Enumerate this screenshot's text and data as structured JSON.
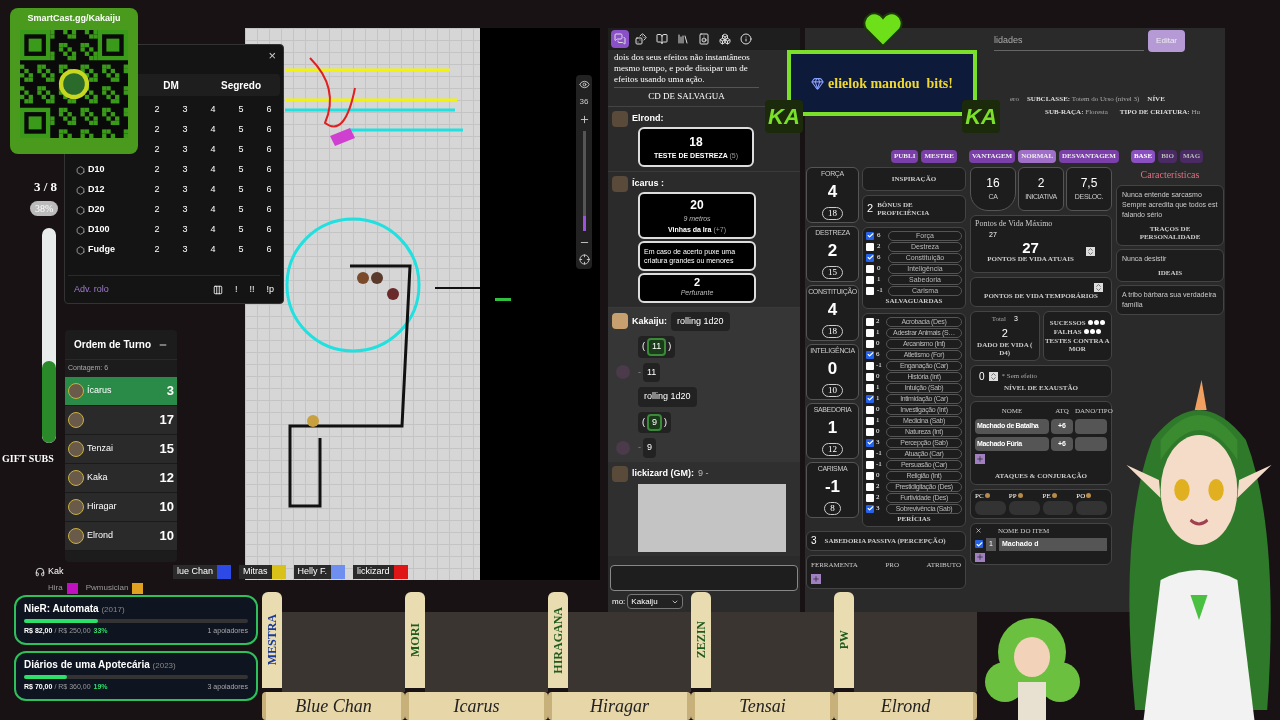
{
  "qr_card": {
    "title": "SmartCast.gg/Kakaiju"
  },
  "sub_goal": {
    "count": "3 / 8",
    "percent": "38%",
    "level": 0.38,
    "label": "GIFT SUBS"
  },
  "dice_panel": {
    "close": "×",
    "columns": [
      "DM",
      "Segredo"
    ],
    "rows": [
      {
        "values": [
          "2",
          "3",
          "4",
          "5",
          "6"
        ]
      },
      {
        "values": [
          "2",
          "3",
          "4",
          "5",
          "6"
        ]
      },
      {
        "values": [
          "2",
          "3",
          "4",
          "5",
          "6"
        ]
      },
      {
        "label": "D10",
        "values": [
          "2",
          "3",
          "4",
          "5",
          "6"
        ]
      },
      {
        "label": "D12",
        "values": [
          "2",
          "3",
          "4",
          "5",
          "6"
        ]
      },
      {
        "label": "D20",
        "values": [
          "2",
          "3",
          "4",
          "5",
          "6"
        ]
      },
      {
        "label": "D100",
        "values": [
          "2",
          "3",
          "4",
          "5",
          "6"
        ]
      },
      {
        "label": "Fudge",
        "values": [
          "2",
          "3",
          "4",
          "5",
          "6"
        ]
      }
    ],
    "footer": {
      "label": "Adv. rolo",
      "buttons": [
        "!",
        "!!",
        "!p"
      ]
    }
  },
  "turn_order": {
    "title": "Ordem de Turno",
    "count": "Contagem: 6",
    "entries": [
      {
        "name": "Ícarus",
        "initiative": "3",
        "selected": true
      },
      {
        "initiative": "17",
        "selected": false
      },
      {
        "name": "Tenzai",
        "initiative": "15",
        "selected": false
      },
      {
        "name": "Kaka",
        "initiative": "12",
        "selected": false
      },
      {
        "name": "Hiragar",
        "initiative": "10",
        "selected": false
      },
      {
        "name": "Elrond",
        "initiative": "10",
        "selected": false
      }
    ]
  },
  "speaker": {
    "name": "Kak"
  },
  "players_top": [
    {
      "name": "lue Chan",
      "color": "#2e4ae6"
    },
    {
      "name": "Mitras",
      "color": "#d8c21a"
    },
    {
      "name": "Helly F.",
      "color": "#6f8ff0"
    },
    {
      "name": "lickizard",
      "color": "#e01515"
    }
  ],
  "players_bottom": [
    {
      "name": "Hira",
      "color": "#c010c0"
    },
    {
      "name": "Pwmusician",
      "color": "#e0a020"
    }
  ],
  "funding_goals": [
    {
      "title": "NieR: Automata",
      "year": "(2017)",
      "raised": "R$ 82,00",
      "target": "/ R$ 250,00",
      "percent": "33%",
      "supporters": "1 apoiadores",
      "level": 0.33
    },
    {
      "title": "Diários de uma Apotecária",
      "year": "(2023)",
      "raised": "R$ 70,00",
      "target": "/ R$ 360,00",
      "percent": "19%",
      "supporters": "3 apoiadores",
      "level": 0.19
    }
  ],
  "map": {
    "zoom": "36",
    "zoom_slider": {
      "level": 0.15
    }
  },
  "chat": {
    "tabs": [
      {
        "kind": "chat",
        "selected": true
      },
      {
        "kind": "dice",
        "selected": false
      },
      {
        "kind": "journal",
        "selected": false
      },
      {
        "kind": "library",
        "selected": false
      },
      {
        "kind": "jukebox",
        "selected": false
      },
      {
        "kind": "collections",
        "selected": false
      },
      {
        "kind": "info",
        "selected": false
      }
    ],
    "spell_snippet": {
      "text": "dois dos seus efeitos não instantâneos mesmo tempo, e pode dissipar um de efeitos usando uma ação.",
      "save_label": "CD DE SALVAGUA"
    },
    "messages": [
      {
        "kind": "check",
        "sender": "Elrond:",
        "total": "18",
        "label": "TESTE DE DESTREZA",
        "modifier": "(5)"
      },
      {
        "kind": "attack",
        "sender": "Ícarus :",
        "total": "20",
        "range": "9 metros",
        "name": "Vinhas da Ira",
        "modifier": "(+7)",
        "description": "Em caso de acerto puxe uma criatura grandes ou menores",
        "damage": "2",
        "damage_type": "Perfurante"
      },
      {
        "kind": "roll",
        "sender": "Kakaiju:",
        "lines": [
          {
            "kind": "command",
            "text": "rolling 1d20"
          },
          {
            "kind": "die",
            "open": "(",
            "text": "11",
            "close": ")"
          },
          {
            "kind": "result",
            "prefix": "-",
            "text": "11"
          },
          {
            "kind": "command",
            "text": "rolling 1d20"
          },
          {
            "kind": "die",
            "open": "(",
            "text": "9",
            "close": ")"
          },
          {
            "kind": "result",
            "prefix": "-",
            "text": "9"
          }
        ]
      },
      {
        "kind": "gm",
        "sender": "lickizard (GM):",
        "text": "9 -"
      }
    ],
    "speak_as": {
      "label": "mo:",
      "value": "Kakaiju"
    }
  },
  "sheet": {
    "search": {
      "value": "lidades"
    },
    "edit_button": "Editar",
    "info_top": [
      {
        "value": "ero"
      },
      {
        "label": "SUBCLASSE:",
        "value": "Totem do Urso (nível 3)"
      },
      {
        "label": "NÍVE"
      }
    ],
    "info_bottom": [
      {
        "label": "SUB-RAÇA:",
        "value": "Floresta"
      },
      {
        "label": "TIPO DE CRIATURA:",
        "value": "Hu"
      }
    ],
    "visibility": [
      "PUBLI",
      "MESTRE"
    ],
    "roll_modes": [
      {
        "label": "VANTAGEM",
        "selected": false
      },
      {
        "label": "NORMAL",
        "selected": true
      },
      {
        "label": "DESVANTAGEM",
        "selected": false
      }
    ],
    "tabs": [
      {
        "label": "BASE",
        "selected": true
      },
      {
        "label": "BIO",
        "selected": false
      },
      {
        "label": "MAG",
        "selected": false
      }
    ],
    "attributes": [
      {
        "name": "FORÇA",
        "modifier": "4",
        "score": "18"
      },
      {
        "name": "DESTREZA",
        "modifier": "2",
        "score": "15"
      },
      {
        "name": "CONSTITUIÇÃO",
        "modifier": "4",
        "score": "18"
      },
      {
        "name": "INTELIGÊNCIA",
        "modifier": "0",
        "score": "10"
      },
      {
        "name": "SABEDORIA",
        "modifier": "1",
        "score": "12"
      },
      {
        "name": "CARISMA",
        "modifier": "-1",
        "score": "8"
      }
    ],
    "inspiration": "INSPIRAÇÃO",
    "proficiency": {
      "value": "2",
      "label": "BÔNUS DE PROFICIÊNCIA"
    },
    "saves": {
      "title": "SALVAGUARDAS",
      "items": [
        {
          "value": "6",
          "name": "Força",
          "checked": true
        },
        {
          "value": "2",
          "name": "Destreza",
          "checked": false
        },
        {
          "value": "6",
          "name": "Constituição",
          "checked": true
        },
        {
          "value": "0",
          "name": "Inteligência",
          "checked": false
        },
        {
          "value": "1",
          "name": "Sabedoria",
          "checked": false
        },
        {
          "value": "-1",
          "name": "Carisma",
          "checked": false
        }
      ]
    },
    "skills": {
      "title": "PERÍCIAS",
      "items": [
        {
          "value": "2",
          "name": "Acrobacia (Des)",
          "checked": false
        },
        {
          "value": "1",
          "name": "Adestrar Animais (S…",
          "checked": false
        },
        {
          "value": "0",
          "name": "Arcanismo (Int)",
          "checked": false
        },
        {
          "value": "6",
          "name": "Atletismo (For)",
          "checked": true
        },
        {
          "value": "-1",
          "name": "Enganação (Car)",
          "checked": false
        },
        {
          "value": "0",
          "name": "História (Int)",
          "checked": false
        },
        {
          "value": "1",
          "name": "Intuição (Sab)",
          "checked": false
        },
        {
          "value": "1",
          "name": "Intimidação (Car)",
          "checked": true
        },
        {
          "value": "0",
          "name": "Investigação (Int)",
          "checked": false
        },
        {
          "value": "1",
          "name": "Medicina (Sab)",
          "checked": false
        },
        {
          "value": "0",
          "name": "Natureza (Int)",
          "checked": false
        },
        {
          "value": "3",
          "name": "Percepção (Sab)",
          "checked": true
        },
        {
          "value": "-1",
          "name": "Atuação (Car)",
          "checked": false
        },
        {
          "value": "-1",
          "name": "Persuasão (Car)",
          "checked": false
        },
        {
          "value": "0",
          "name": "Religião (Int)",
          "checked": false
        },
        {
          "value": "2",
          "name": "Prestidigitação (Des)",
          "checked": false
        },
        {
          "value": "2",
          "name": "Furtividade (Des)",
          "checked": false
        },
        {
          "value": "3",
          "name": "Sobrevivência (Sab)",
          "checked": true
        }
      ]
    },
    "passive": {
      "value": "3",
      "label": "SABEDORIA PASSIVA (PERCEPÇÃO)"
    },
    "tools": {
      "columns": [
        "FERRAMENTA",
        "PRO",
        "ATRIBUTO"
      ]
    },
    "combat": [
      {
        "kind": "shield",
        "value": "16",
        "label": "CA"
      },
      {
        "kind": "box",
        "value": "2",
        "label": "INICIATIVA"
      },
      {
        "kind": "box",
        "value": "7,5",
        "label": "DESLOC."
      }
    ],
    "hp": {
      "max_label": "Pontos de Vida Máximo",
      "max": "27",
      "current": "27",
      "current_label": "PONTOS DE VIDA ATUAIS",
      "temp_label": "PONTOS DE VIDA TEMPORÁRIOS"
    },
    "hit_dice": {
      "total_label": "Total",
      "total": "3",
      "value": "2",
      "label": "DADO DE VIDA",
      "die": "( D4)"
    },
    "death_saves": {
      "successes": "SUCESSOS",
      "failures": "FALHAS",
      "label": "TESTES CONTRA A MOR"
    },
    "exhaustion": {
      "value": "0",
      "note": "* Sem efeito",
      "label": "NÍVEL DE EXAUSTÃO"
    },
    "attacks": {
      "columns": [
        "NOME",
        "ATQ",
        "DANO/TIPO"
      ],
      "rows": [
        {
          "name": "Machado de Batalha",
          "bonus": "+6"
        },
        {
          "name": "Machado Fúria",
          "bonus": "+6"
        }
      ],
      "title": "ATAQUES & CONJURAÇÃO"
    },
    "coins": [
      "PC",
      "PP",
      "PE",
      "PO"
    ],
    "items": {
      "column": "NOME DO ITEM",
      "rows": [
        {
          "checked": true,
          "quantity": "1",
          "name": "Machado d"
        }
      ]
    },
    "traits": {
      "title": "Características",
      "sections": [
        {
          "text": "Nunca entende sarcasmo Sempre acredita que todos est falando sério",
          "label": "TRAÇOS DE PERSONALIDADE"
        },
        {
          "text": "Nunca desistir",
          "label": "IDEAIS"
        },
        {
          "text": "A tribo bárbara sua verdadeira família"
        }
      ]
    }
  },
  "alert": {
    "text": "elielok mandou  bits!",
    "badges": [
      "KA",
      "KA"
    ]
  },
  "portraits": [
    {
      "tag": "MESTRA",
      "name": "Blue Chan",
      "color": "#1a3a9a"
    },
    {
      "tag": "MORI",
      "name": "Icarus",
      "color": "#1f5a1f"
    },
    {
      "tag": "HIRAGANA",
      "name": "Hiragar",
      "color": "#1f5a1f"
    },
    {
      "tag": "ZEZIN",
      "name": "Tensai",
      "color": "#1f5a1f"
    },
    {
      "tag": "PW",
      "name": "Elrond",
      "color": "#1f5a1f"
    }
  ]
}
